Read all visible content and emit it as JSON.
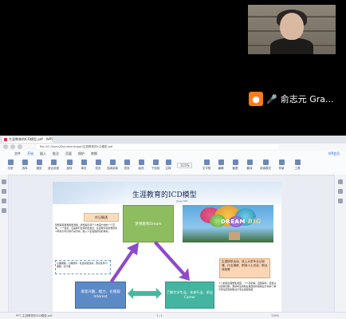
{
  "meeting": {
    "participant_name": "俞志元 Gra...",
    "participant_icon": "user-icon",
    "mic_icon": "mic-icon"
  },
  "browser": {
    "tab_title": "生涯教育的ICD模型.pdf - WPS",
    "url": "file:///C:/Users/Documents/ppt/生涯教育的ICD模型.pdf"
  },
  "menu": {
    "items": [
      "文件",
      "开始",
      "插入",
      "批注",
      "页面",
      "保护",
      "转换"
    ],
    "active_index": 1,
    "vip": "VIP会员"
  },
  "toolbar": {
    "zoom": "115%",
    "tools": [
      "手型",
      "选择",
      "缩放",
      "适合页面",
      "旋转",
      "单页",
      "双页",
      "连续阅读",
      "查找",
      "高亮",
      "下划线",
      "注释",
      "文字框",
      "编辑",
      "截图",
      "翻译",
      "阅读模式",
      "背景",
      "工具"
    ]
  },
  "status": {
    "file_name": "PPT_生涯教育的ICD模型.pdf",
    "page": "1 / 1",
    "zoom": "115%"
  },
  "slide": {
    "title": "生涯教育的ICD模型",
    "author": "俞志元 2021",
    "vision_tag": "作记确涌",
    "vision_text": "梦想是有着规划和激励、梦想是引领个人未来方向的一个空间，一个目标，它是我们生涯的出发点，生涯教育将梦想的意义转化为可行的行动方向，融入人生发展的目标体系。",
    "dream_box": "梦想教育Dream",
    "dream_word": "DREAM",
    "big_word": "BIG",
    "left_mid": "心理课程，心理测评，社会实践活动，研究性学习课程，实习等",
    "right_mid": "生涯研学活动，线上大学专业认知课，行业调研，职场人士访谈，职业体验等",
    "interest_box": "发现兴趣，能力，价值观 Interest",
    "career_box": "了解大学专业，未来行业，职业 Career",
    "right_low": "个人的职业理想和发展，个人目标等，自我探索，自我认识自我归纳，规划中生的职业发展目标和职业方向并了解与学生匹配的职业与专业发展路径"
  }
}
